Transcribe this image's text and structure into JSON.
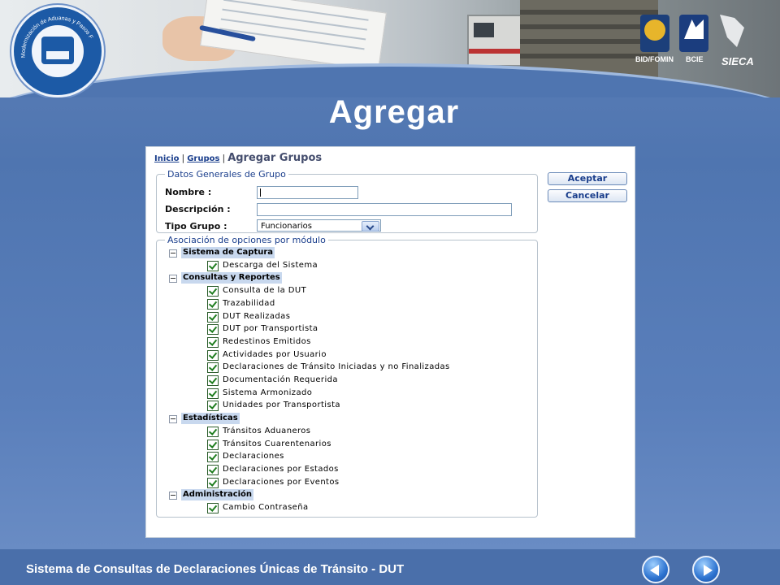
{
  "slide": {
    "title": "Agregar",
    "footer": "Sistema de Consultas de Declaraciones Únicas de Tránsito - DUT"
  },
  "banner": {
    "logo_text": "Modernización de Aduanas y Pasos Fronterizos",
    "sponsors": [
      "BID/FOMIN",
      "BCIE",
      "SIECA"
    ]
  },
  "app": {
    "breadcrumb": {
      "home": "Inicio",
      "groups": "Grupos",
      "current": "Agregar Grupos"
    },
    "general": {
      "legend": "Datos Generales de Grupo",
      "name_label": "Nombre :",
      "name_value": "",
      "desc_label": "Descripción :",
      "desc_value": "",
      "type_label": "Tipo Grupo :",
      "type_value": "Funcionarios"
    },
    "buttons": {
      "accept": "Aceptar",
      "cancel": "Cancelar"
    },
    "modules": {
      "legend": "Asociación de opciones por módulo",
      "groups": [
        {
          "name": "Sistema de Captura",
          "items": [
            "Descarga del Sistema"
          ]
        },
        {
          "name": "Consultas y Reportes",
          "items": [
            "Consulta de la DUT",
            "Trazabilidad",
            "DUT Realizadas",
            "DUT por Transportista",
            "Redestinos Emitidos",
            "Actividades por Usuario",
            "Declaraciones de Tránsito Iniciadas y no Finalizadas",
            "Documentación Requerida",
            "Sistema Armonizado",
            "Unidades por Transportista"
          ]
        },
        {
          "name": "Estadísticas",
          "items": [
            "Tránsitos Aduaneros",
            "Tránsitos Cuarentenarios",
            "Declaraciones",
            "Declaraciones por Estados",
            "Declaraciones por Eventos"
          ]
        },
        {
          "name": "Administración",
          "items": [
            "Cambio Contraseña"
          ]
        }
      ]
    }
  }
}
